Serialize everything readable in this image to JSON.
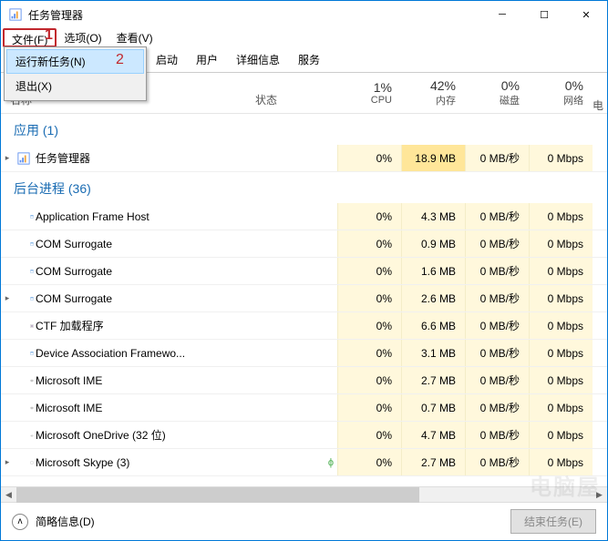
{
  "window": {
    "title": "任务管理器"
  },
  "menubar": [
    "文件(F)",
    "选项(O)",
    "查看(V)"
  ],
  "dropdown": {
    "run_new_task": "运行新任务(N)",
    "exit": "退出(X)"
  },
  "annotations": {
    "one": "1",
    "two": "2"
  },
  "tabs_partial": [
    "启动",
    "用户",
    "详细信息",
    "服务"
  ],
  "columns": {
    "name": "名称",
    "status": "状态",
    "cpu_pct": "1%",
    "cpu": "CPU",
    "mem_pct": "42%",
    "mem": "内存",
    "disk_pct": "0%",
    "disk": "磁盘",
    "net_pct": "0%",
    "net": "网络",
    "extra": "电"
  },
  "groups": {
    "apps": {
      "label": "应用 (1)"
    },
    "bg": {
      "label": "后台进程 (36)"
    }
  },
  "rows": [
    {
      "grp": "apps",
      "expand": "▸",
      "icon": "taskmgr",
      "name": "任务管理器",
      "leaf": "",
      "cpu": "0%",
      "mem": "18.9 MB",
      "memhl": true,
      "disk": "0 MB/秒",
      "net": "0 Mbps"
    },
    {
      "grp": "bg",
      "expand": "",
      "icon": "app",
      "name": "Application Frame Host",
      "leaf": "",
      "cpu": "0%",
      "mem": "4.3 MB",
      "memhl": false,
      "disk": "0 MB/秒",
      "net": "0 Mbps"
    },
    {
      "grp": "bg",
      "expand": "",
      "icon": "app",
      "name": "COM Surrogate",
      "leaf": "",
      "cpu": "0%",
      "mem": "0.9 MB",
      "memhl": false,
      "disk": "0 MB/秒",
      "net": "0 Mbps"
    },
    {
      "grp": "bg",
      "expand": "",
      "icon": "app",
      "name": "COM Surrogate",
      "leaf": "",
      "cpu": "0%",
      "mem": "1.6 MB",
      "memhl": false,
      "disk": "0 MB/秒",
      "net": "0 Mbps"
    },
    {
      "grp": "bg",
      "expand": "▸",
      "icon": "app",
      "name": "COM Surrogate",
      "leaf": "",
      "cpu": "0%",
      "mem": "2.6 MB",
      "memhl": false,
      "disk": "0 MB/秒",
      "net": "0 Mbps"
    },
    {
      "grp": "bg",
      "expand": "",
      "icon": "ctf",
      "name": "CTF 加载程序",
      "leaf": "",
      "cpu": "0%",
      "mem": "6.6 MB",
      "memhl": false,
      "disk": "0 MB/秒",
      "net": "0 Mbps"
    },
    {
      "grp": "bg",
      "expand": "",
      "icon": "app",
      "name": "Device Association Framewo...",
      "leaf": "",
      "cpu": "0%",
      "mem": "3.1 MB",
      "memhl": false,
      "disk": "0 MB/秒",
      "net": "0 Mbps"
    },
    {
      "grp": "bg",
      "expand": "",
      "icon": "ime",
      "name": "Microsoft IME",
      "leaf": "",
      "cpu": "0%",
      "mem": "2.7 MB",
      "memhl": false,
      "disk": "0 MB/秒",
      "net": "0 Mbps"
    },
    {
      "grp": "bg",
      "expand": "",
      "icon": "ime",
      "name": "Microsoft IME",
      "leaf": "",
      "cpu": "0%",
      "mem": "0.7 MB",
      "memhl": false,
      "disk": "0 MB/秒",
      "net": "0 Mbps"
    },
    {
      "grp": "bg",
      "expand": "",
      "icon": "onedrive",
      "name": "Microsoft OneDrive (32 位)",
      "leaf": "",
      "cpu": "0%",
      "mem": "4.7 MB",
      "memhl": false,
      "disk": "0 MB/秒",
      "net": "0 Mbps"
    },
    {
      "grp": "bg",
      "expand": "▸",
      "icon": "skype",
      "name": "Microsoft Skype (3)",
      "leaf": "ϕ",
      "cpu": "0%",
      "mem": "2.7 MB",
      "memhl": false,
      "disk": "0 MB/秒",
      "net": "0 Mbps"
    }
  ],
  "footer": {
    "less": "简略信息(D)",
    "end_task": "结束任务(E)"
  },
  "watermark": "电脑屋"
}
